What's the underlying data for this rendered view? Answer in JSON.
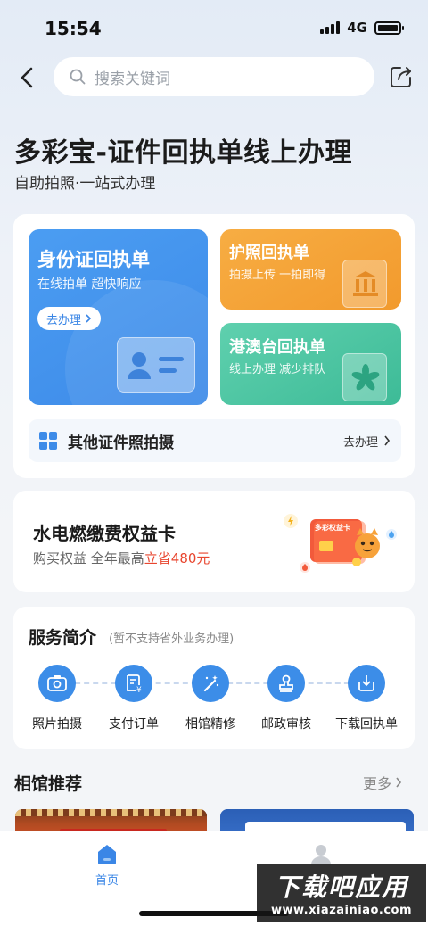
{
  "status_bar": {
    "time": "15:54",
    "network": "4G"
  },
  "search": {
    "placeholder": "搜索关键词"
  },
  "header": {
    "title": "多彩宝-证件回执单线上办理",
    "subtitle": "自助拍照·一站式办理"
  },
  "tiles": {
    "id_card": {
      "title": "身份证回执单",
      "subtitle": "在线拍单 超快响应",
      "button": "去办理"
    },
    "passport": {
      "title": "护照回执单",
      "subtitle": "拍摄上传 一拍即得"
    },
    "hmt": {
      "title": "港澳台回执单",
      "subtitle": "线上办理 减少排队"
    },
    "other": {
      "label": "其他证件照拍摄",
      "action": "去办理"
    }
  },
  "benefit": {
    "title": "水电燃缴费权益卡",
    "subtitle_prefix": "购买权益 全年最高",
    "subtitle_highlight": "立省480元",
    "card_label": "多彩权益卡"
  },
  "services": {
    "title": "服务简介",
    "note": "(暂不支持省外业务办理)",
    "items": [
      {
        "label": "照片拍摄",
        "icon": "camera-icon"
      },
      {
        "label": "支付订单",
        "icon": "receipt-icon"
      },
      {
        "label": "相馆精修",
        "icon": "magic-wand-icon"
      },
      {
        "label": "邮政审核",
        "icon": "stamp-icon"
      },
      {
        "label": "下载回执单",
        "icon": "download-icon"
      }
    ]
  },
  "recommend": {
    "title": "相馆推荐",
    "more": "更多"
  },
  "tabbar": {
    "home": "首页"
  },
  "watermark": {
    "title": "下载吧应用",
    "url": "www.xiazainiao.com"
  },
  "colors": {
    "primary": "#3c8de8",
    "orange": "#f29a2d",
    "green": "#3dbb97",
    "highlight": "#e8462f"
  }
}
